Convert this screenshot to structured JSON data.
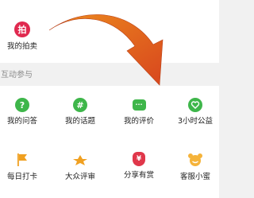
{
  "top": {
    "item": {
      "label": "我的拍卖",
      "icon_char": "拍",
      "icon": "auction-icon"
    }
  },
  "section": {
    "title": "互动参与"
  },
  "rows": [
    [
      {
        "label": "我的问答",
        "icon_char": "?",
        "icon": "question-icon"
      },
      {
        "label": "我的话题",
        "icon_char": "#",
        "icon": "hashtag-icon"
      },
      {
        "label": "我的评价",
        "icon_char": "···",
        "icon": "comment-icon"
      },
      {
        "label": "3小时公益",
        "icon_char": "",
        "icon": "heart-icon"
      }
    ],
    [
      {
        "label": "每日打卡",
        "icon_char": "",
        "icon": "flag-icon"
      },
      {
        "label": "大众评审",
        "icon_char": "",
        "icon": "glasses-icon"
      },
      {
        "label": "分享有赏",
        "icon_char": "¥",
        "icon": "money-bag-icon"
      },
      {
        "label": "客服小蜜",
        "icon_char": "",
        "icon": "support-honey-icon"
      }
    ]
  ],
  "colors": {
    "accent_red": "#e0294f",
    "green": "#3eb64a",
    "gold": "#f0a020",
    "arrow": "#e8601c"
  }
}
